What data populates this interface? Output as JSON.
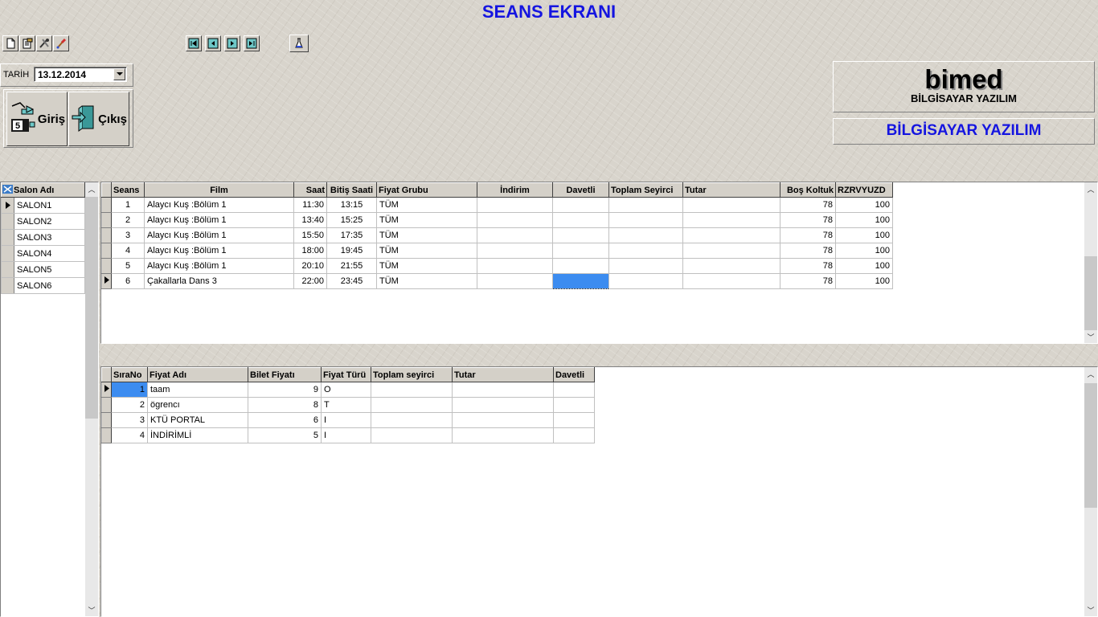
{
  "window_title": "SEANS EKRANI",
  "toolbar": {
    "left_icons": [
      "new-document-icon",
      "edit-document-icon",
      "tools-icon",
      "brush-icon"
    ],
    "nav_icons": [
      "first-record-icon",
      "prev-record-icon",
      "next-record-icon",
      "last-record-icon"
    ],
    "extra_icon": "flask-icon"
  },
  "date": {
    "label": "TARİH",
    "value": "13.12.2014"
  },
  "buttons": {
    "entry": "Giriş",
    "exit": "Çıkış"
  },
  "brand": {
    "name": "bimed",
    "subtitle": "BİLGİSAYAR YAZILIM",
    "banner": "BİLGİSAYAR YAZILIM"
  },
  "salon_list": {
    "header": "Salon Adı",
    "items": [
      "SALON1",
      "SALON2",
      "SALON3",
      "SALON4",
      "SALON5",
      "SALON6"
    ],
    "selected_index": 0
  },
  "sessions": {
    "columns": [
      "Seans",
      "Film",
      "Saat",
      "Bitiş Saati",
      "Fiyat Grubu",
      "İndirim",
      "Davetli",
      "Toplam Seyirci",
      "Tutar",
      "Boş Koltuk",
      "RZRVYUZD"
    ],
    "rows": [
      [
        "1",
        "Alaycı Kuş :Bölüm 1",
        "11:30",
        "13:15",
        "TÜM",
        "",
        "",
        "",
        "",
        "78",
        "100"
      ],
      [
        "2",
        "Alaycı Kuş :Bölüm 1",
        "13:40",
        "15:25",
        "TÜM",
        "",
        "",
        "",
        "",
        "78",
        "100"
      ],
      [
        "3",
        "Alaycı Kuş :Bölüm 1",
        "15:50",
        "17:35",
        "TÜM",
        "",
        "",
        "",
        "",
        "78",
        "100"
      ],
      [
        "4",
        "Alaycı Kuş :Bölüm 1",
        "18:00",
        "19:45",
        "TÜM",
        "",
        "",
        "",
        "",
        "78",
        "100"
      ],
      [
        "5",
        "Alaycı Kuş :Bölüm 1",
        "20:10",
        "21:55",
        "TÜM",
        "",
        "",
        "",
        "",
        "78",
        "100"
      ],
      [
        "6",
        "Çakallarla Dans 3",
        "22:00",
        "23:45",
        "TÜM",
        "",
        "",
        "",
        "",
        "78",
        "100"
      ]
    ],
    "current_row": 5
  },
  "prices": {
    "columns": [
      "SıraNo",
      "Fiyat Adı",
      "Bilet Fiyatı",
      "Fiyat Türü",
      "Toplam seyirci",
      "Tutar",
      "Davetli"
    ],
    "rows": [
      [
        "1",
        "taam",
        "9",
        "O",
        "",
        "",
        ""
      ],
      [
        "2",
        "ögrencı",
        "8",
        "T",
        "",
        "",
        ""
      ],
      [
        "3",
        "KTÜ PORTAL",
        "6",
        "I",
        "",
        "",
        ""
      ],
      [
        "4",
        "İNDİRİMLİ",
        "5",
        "I",
        "",
        "",
        ""
      ]
    ],
    "current_row": 0
  }
}
